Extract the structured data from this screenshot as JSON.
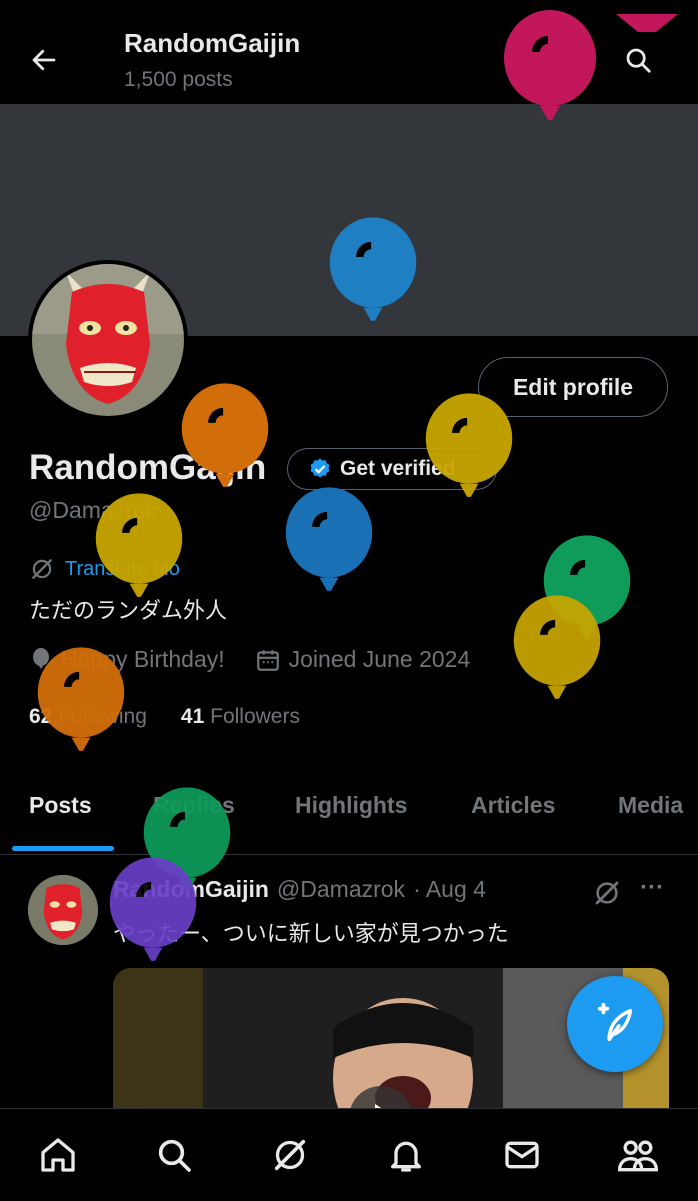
{
  "header": {
    "title": "RandomGaijin",
    "post_count": "1,500 posts"
  },
  "profile": {
    "edit_profile_label": "Edit profile",
    "display_name": "RandomGaijin",
    "get_verified_label": "Get verified",
    "handle": "@Damazrok",
    "translate_bio_label": "Translate bio",
    "bio": "ただのランダム外人",
    "birthday": "Happy Birthday!",
    "joined": "Joined June 2024",
    "following_count": "62",
    "following_label": "Following",
    "followers_count": "41",
    "followers_label": "Followers"
  },
  "tabs": [
    {
      "label": "Posts",
      "active": true
    },
    {
      "label": "Replies"
    },
    {
      "label": "Highlights"
    },
    {
      "label": "Articles"
    },
    {
      "label": "Media"
    }
  ],
  "post": {
    "name": "RandomGaijin",
    "handle": "@Damazrok",
    "date": "· Aug 4",
    "text": "やったー、ついに新しい家が見つかった",
    "more_label": "···"
  },
  "bottom_nav": [
    "home-icon",
    "search-icon",
    "grok-icon",
    "notifications-icon",
    "messages-icon",
    "communities-icon"
  ],
  "colors": {
    "accent": "#1d9bf0",
    "background": "#000000",
    "banner": "#33363a",
    "balloons": [
      "#c2185b",
      "#1e7fc2",
      "#d26e0a",
      "#c9a600",
      "#0f9b5a",
      "#6a3fc8"
    ]
  }
}
